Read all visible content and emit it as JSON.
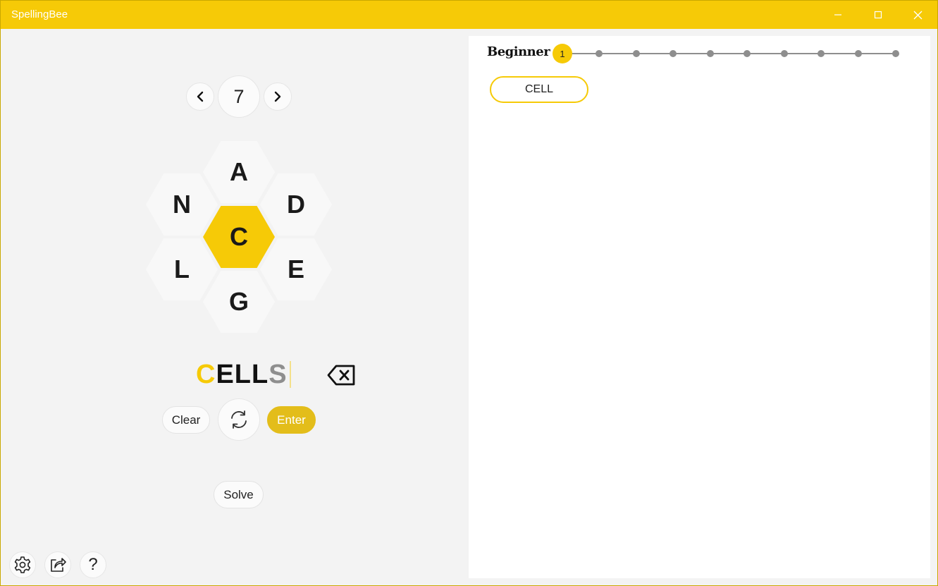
{
  "window": {
    "title": "SpellingBee",
    "controls": [
      "minimize-icon",
      "maximize-icon",
      "close-icon"
    ]
  },
  "puzzle_nav": {
    "prev_icon": "chevron-left-icon",
    "number": "7",
    "next_icon": "chevron-right-icon"
  },
  "hive": {
    "center": "C",
    "top": "A",
    "upper_left": "N",
    "upper_right": "D",
    "lower_left": "L",
    "lower_right": "E",
    "bottom": "G"
  },
  "input": {
    "segments": [
      {
        "text": "C",
        "style": "center-letter"
      },
      {
        "text": "ELL",
        "style": "valid-letter"
      },
      {
        "text": "S",
        "style": "invalid-letter"
      }
    ],
    "backspace_icon": "backspace-icon"
  },
  "actions": {
    "clear_label": "Clear",
    "shuffle_icon": "shuffle-icon",
    "enter_label": "Enter",
    "solve_label": "Solve"
  },
  "bottom_bar": {
    "settings_icon": "gear-icon",
    "share_icon": "share-icon",
    "help_icon": "help-icon",
    "help_glyph": "?"
  },
  "progress": {
    "level": "Beginner",
    "current_step": "1",
    "total_steps": 10
  },
  "found_words": [
    "CELL"
  ],
  "colors": {
    "accent": "#f6ca07",
    "enter_button": "#e3bd1a",
    "panel": "#ffffff",
    "background": "#f3f3f3",
    "track": "#8e8e8e"
  }
}
